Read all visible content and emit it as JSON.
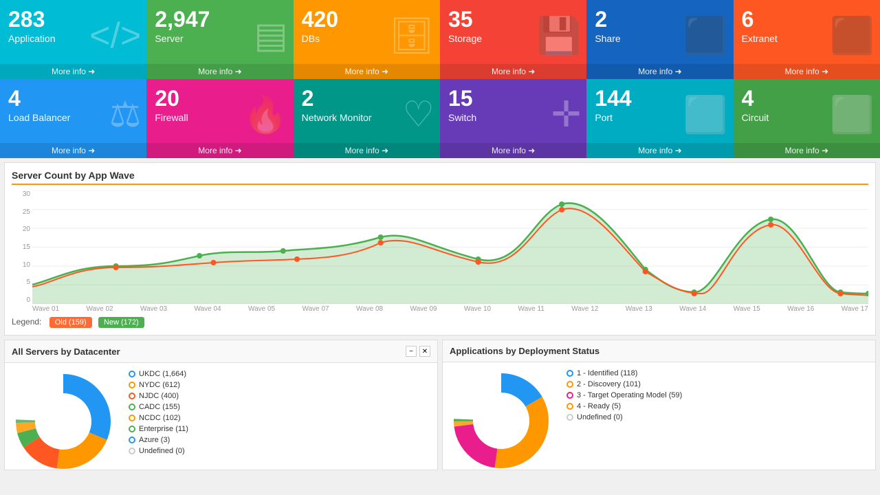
{
  "topRow": [
    {
      "id": "application",
      "number": "283",
      "label": "Application",
      "bg": "bg-cyan",
      "icon": "</>"
    },
    {
      "id": "server",
      "number": "2,947",
      "label": "Server",
      "bg": "bg-green",
      "icon": "☰"
    },
    {
      "id": "dbs",
      "number": "420",
      "label": "DBs",
      "bg": "bg-orange",
      "icon": "🗄"
    },
    {
      "id": "storage",
      "number": "35",
      "label": "Storage",
      "bg": "bg-red",
      "icon": "💾"
    },
    {
      "id": "share",
      "number": "2",
      "label": "Share",
      "bg": "bg-blue-dark",
      "icon": "⬛"
    },
    {
      "id": "extranet",
      "number": "6",
      "label": "Extranet",
      "bg": "bg-orange2",
      "icon": "⬛"
    }
  ],
  "bottomRow": [
    {
      "id": "loadbalancer",
      "number": "4",
      "label": "Load Balancer",
      "bg": "bg-blue-mid",
      "icon": "⚖"
    },
    {
      "id": "firewall",
      "number": "20",
      "label": "Firewall",
      "bg": "bg-pink",
      "icon": "🔥"
    },
    {
      "id": "networkmonitor",
      "number": "2",
      "label": "Network Monitor",
      "bg": "bg-teal",
      "icon": "♡"
    },
    {
      "id": "switch",
      "number": "15",
      "label": "Switch",
      "bg": "bg-purple",
      "icon": "✛"
    },
    {
      "id": "port",
      "number": "144",
      "label": "Port",
      "bg": "bg-cyan2",
      "icon": "⬜"
    },
    {
      "id": "circuit",
      "number": "4",
      "label": "Circuit",
      "bg": "bg-green2",
      "icon": "⬜"
    }
  ],
  "moreInfo": "More info ➜",
  "chart": {
    "title": "Server Count by App Wave",
    "xLabels": [
      "Wave 01",
      "Wave 02",
      "Wave 03",
      "Wave 04",
      "Wave 05",
      "Wave 07",
      "Wave 08",
      "Wave 09",
      "Wave 10",
      "Wave 11",
      "Wave 12",
      "Wave 13",
      "Wave 14",
      "Wave 15",
      "Wave 16",
      "Wave 17"
    ],
    "yLabels": [
      "30",
      "25",
      "20",
      "15",
      "10",
      "5",
      "0"
    ],
    "legend": {
      "old": "Old (159)",
      "new": "New (172)"
    }
  },
  "datacenterPanel": {
    "title": "All Servers by Datacenter",
    "items": [
      {
        "label": "UKDC",
        "value": "1,664",
        "color": "#2196f3"
      },
      {
        "label": "NYDC",
        "value": "612",
        "color": "#ff9800"
      },
      {
        "label": "NJDC",
        "value": "400",
        "color": "#ff5722"
      },
      {
        "label": "CADC",
        "value": "155",
        "color": "#4caf50"
      },
      {
        "label": "NCDC",
        "value": "102",
        "color": "#ff9800"
      },
      {
        "label": "Enterprise",
        "value": "11",
        "color": "#4caf50"
      },
      {
        "label": "Azure",
        "value": "3",
        "color": "#2196f3"
      },
      {
        "label": "Undefined",
        "value": "0",
        "color": "#ccc"
      }
    ]
  },
  "deploymentPanel": {
    "title": "Applications by Deployment Status",
    "items": [
      {
        "label": "1 - Identified",
        "value": "118",
        "color": "#2196f3"
      },
      {
        "label": "2 - Discovery",
        "value": "101",
        "color": "#ff9800"
      },
      {
        "label": "3 - Target Operating Model",
        "value": "59",
        "color": "#e91e8c"
      },
      {
        "label": "4 - Ready",
        "value": "5",
        "color": "#ff9800"
      },
      {
        "label": "Undefined",
        "value": "0",
        "color": "#ccc"
      }
    ]
  }
}
